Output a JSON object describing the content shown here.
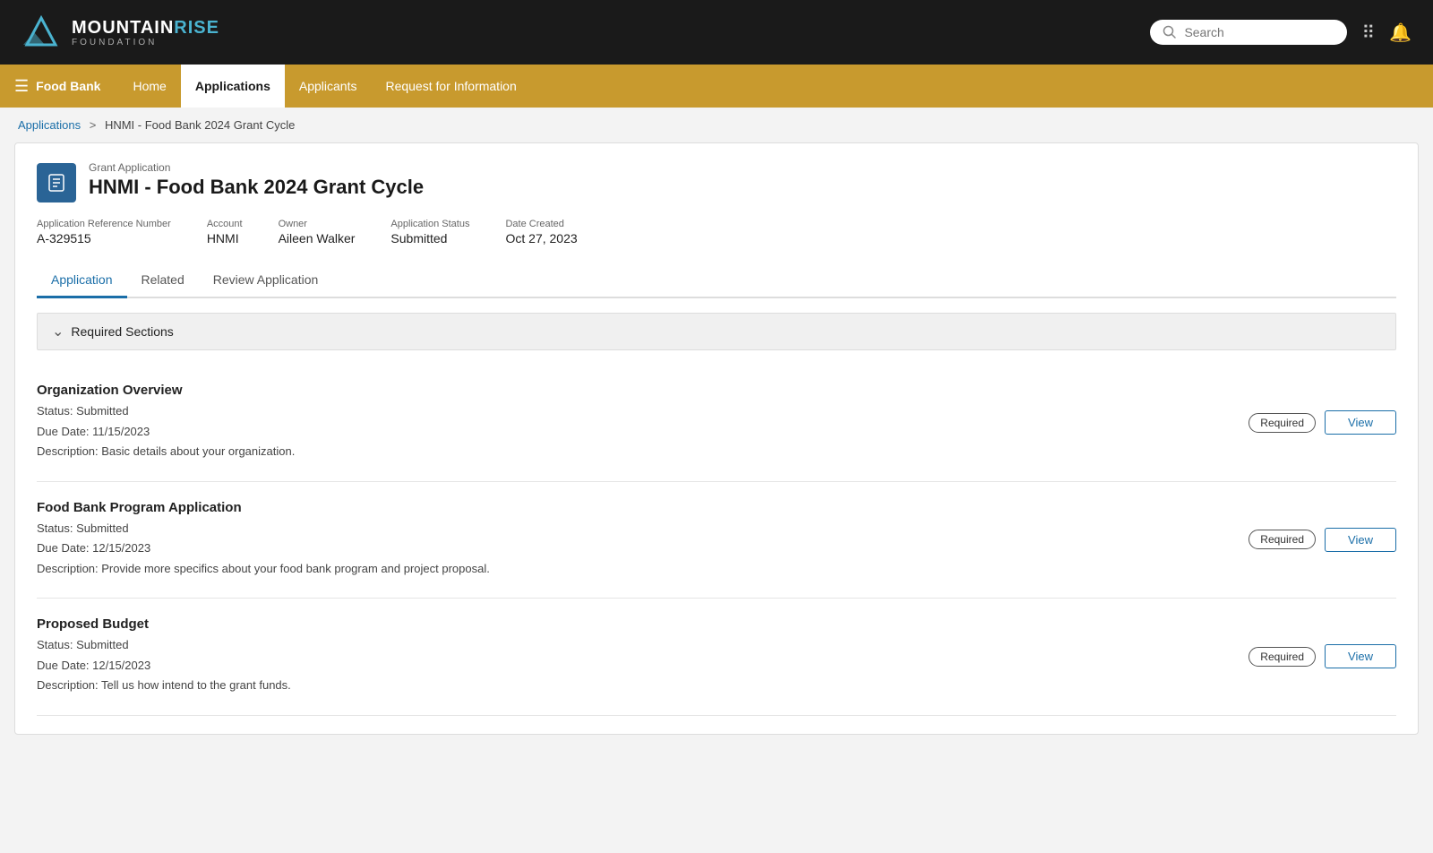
{
  "topNav": {
    "logoName": "MOUNTAINRISE",
    "logoNameHighlight": "RISE",
    "logoSub": "FOUNDATION",
    "search": {
      "placeholder": "Search"
    }
  },
  "secNav": {
    "orgLabel": "Food Bank",
    "items": [
      {
        "id": "home",
        "label": "Home",
        "active": false
      },
      {
        "id": "applications",
        "label": "Applications",
        "active": true
      },
      {
        "id": "applicants",
        "label": "Applicants",
        "active": false
      },
      {
        "id": "rfi",
        "label": "Request for Information",
        "active": false
      }
    ]
  },
  "breadcrumb": {
    "links": [
      {
        "label": "Applications",
        "href": "#"
      }
    ],
    "separator": ">",
    "current": "HNMI - Food Bank 2024 Grant Cycle"
  },
  "application": {
    "grantLabel": "Grant Application",
    "title": "HNMI - Food Bank 2024 Grant Cycle",
    "meta": {
      "refNumLabel": "Application Reference Number",
      "refNum": "A-329515",
      "accountLabel": "Account",
      "account": "HNMI",
      "ownerLabel": "Owner",
      "owner": "Aileen Walker",
      "statusLabel": "Application Status",
      "status": "Submitted",
      "dateCreatedLabel": "Date Created",
      "dateCreated": "Oct 27, 2023"
    },
    "tabs": [
      {
        "id": "application",
        "label": "Application",
        "active": true
      },
      {
        "id": "related",
        "label": "Related",
        "active": false
      },
      {
        "id": "review",
        "label": "Review Application",
        "active": false
      }
    ],
    "sectionHeader": {
      "label": "Required Sections",
      "collapsed": false
    },
    "sections": [
      {
        "id": "org-overview",
        "title": "Organization Overview",
        "status": "Status: Submitted",
        "dueDate": "Due Date: 11/15/2023",
        "description": "Description: Basic details about your organization.",
        "badgeLabel": "Required",
        "viewLabel": "View"
      },
      {
        "id": "food-bank-program",
        "title": "Food Bank Program Application",
        "status": "Status: Submitted",
        "dueDate": "Due Date: 12/15/2023",
        "description": "Description: Provide more specifics about your food bank program and project proposal.",
        "badgeLabel": "Required",
        "viewLabel": "View"
      },
      {
        "id": "proposed-budget",
        "title": "Proposed Budget",
        "status": "Status: Submitted",
        "dueDate": "Due Date: 12/15/2023",
        "description": "Description: Tell us how intend to the grant funds.",
        "badgeLabel": "Required",
        "viewLabel": "View"
      }
    ]
  }
}
